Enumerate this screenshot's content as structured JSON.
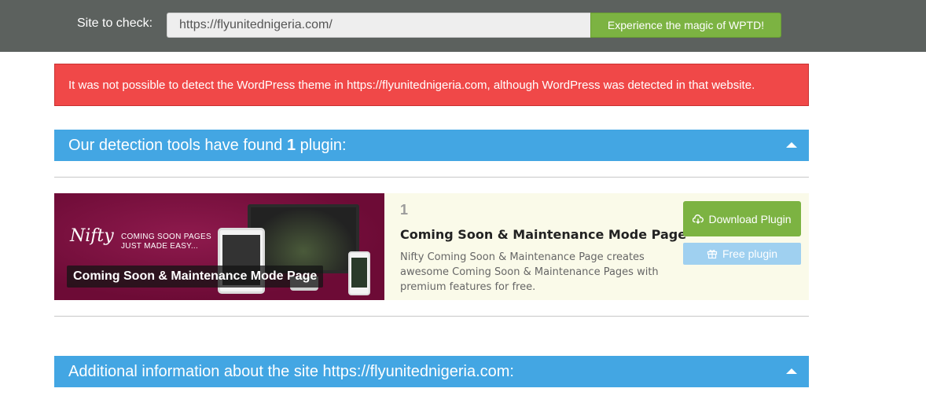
{
  "topbar": {
    "site_label": "Site to check:",
    "url_value": "https://flyunitednigeria.com/",
    "submit_label": "Experience the magic of WPTD!"
  },
  "alert": {
    "message": "It was not possible to detect the WordPress theme in https://flyunitednigeria.com, although WordPress was detected in that website."
  },
  "plugins_section": {
    "title_prefix": "Our detection tools have found ",
    "count": "1",
    "title_suffix": " plugin:"
  },
  "plugins": [
    {
      "number": "1",
      "title": "Coming Soon & Maintenance Mode Page",
      "banner_caption": "Coming Soon & Maintenance Mode Page",
      "banner_logo": "Nifty",
      "banner_tagline_1": "COMING SOON PAGES",
      "banner_tagline_2": "JUST MADE EASY...",
      "description": "Nifty Coming Soon & Maintenance Page creates awesome Coming Soon & Maintenance Pages with premium features for free.",
      "download_label": "Download Plugin",
      "free_label": "Free plugin"
    }
  ],
  "additional_section": {
    "title": "Additional information about the site https://flyunitednigeria.com:"
  },
  "colors": {
    "topbar": "#5c615e",
    "accent_green": "#7cb342",
    "section_blue": "#43a6e3",
    "alert_red": "#f04848",
    "card_bg": "#fafae9"
  },
  "icons": {
    "download": "cloud-download-icon",
    "free": "gift-icon",
    "collapse": "caret-up-icon"
  }
}
